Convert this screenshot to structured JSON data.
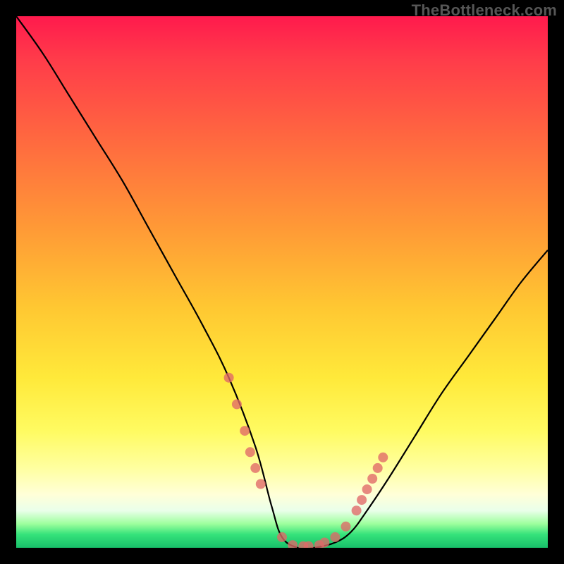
{
  "watermark": "TheBottleneck.com",
  "chart_data": {
    "type": "line",
    "title": "",
    "xlabel": "",
    "ylabel": "",
    "xlim": [
      0,
      100
    ],
    "ylim": [
      0,
      100
    ],
    "series": [
      {
        "name": "bottleneck-curve",
        "x": [
          0,
          5,
          10,
          15,
          20,
          25,
          30,
          35,
          40,
          45,
          48,
          50,
          53,
          56,
          60,
          63,
          66,
          70,
          75,
          80,
          85,
          90,
          95,
          100
        ],
        "y": [
          100,
          93,
          85,
          77,
          69,
          60,
          51,
          42,
          32,
          19,
          8,
          2,
          0,
          0,
          1,
          3,
          7,
          13,
          21,
          29,
          36,
          43,
          50,
          56
        ]
      }
    ],
    "highlight_points": {
      "name": "markers",
      "x": [
        40,
        41.5,
        43,
        44,
        45,
        46,
        50,
        52,
        54,
        55,
        57,
        58,
        60,
        62,
        64,
        65,
        66,
        67,
        68,
        69
      ],
      "y": [
        32,
        27,
        22,
        18,
        15,
        12,
        2,
        0.5,
        0.3,
        0.3,
        0.5,
        1,
        2,
        4,
        7,
        9,
        11,
        13,
        15,
        17
      ]
    },
    "gradient_bands": [
      {
        "color": "#ff1a4d",
        "stop": 0
      },
      {
        "color": "#ffe93a",
        "stop": 68
      },
      {
        "color": "#18c06a",
        "stop": 100
      }
    ]
  }
}
